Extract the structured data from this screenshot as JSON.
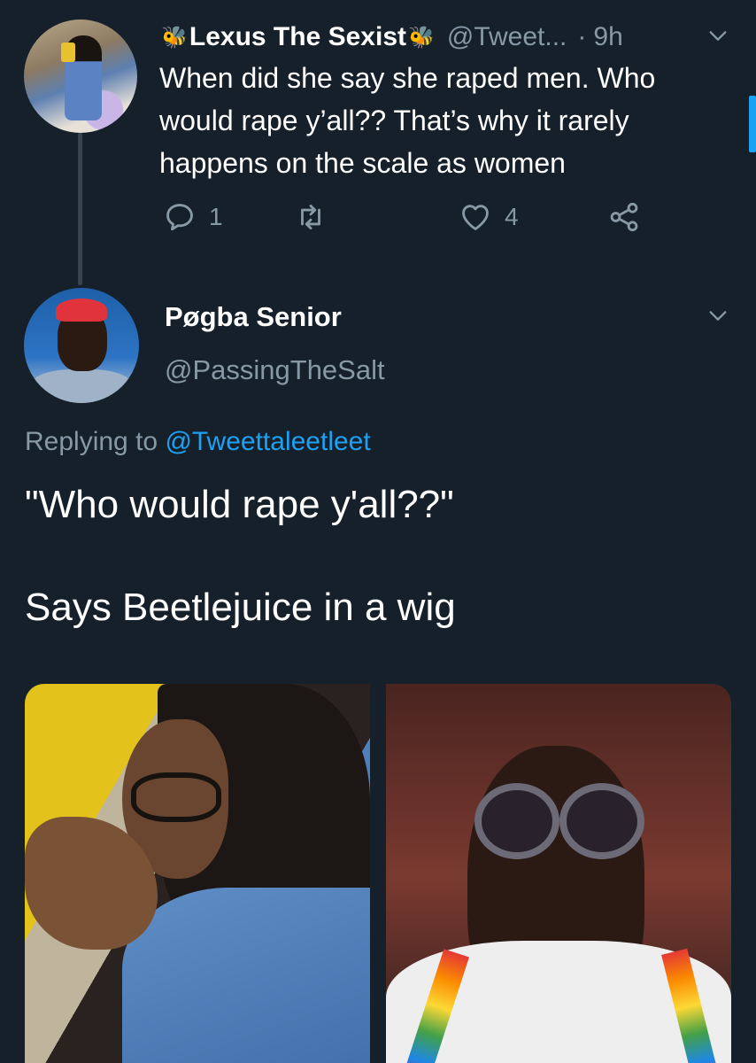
{
  "parent_tweet": {
    "display_name": "Lexus The Sexist",
    "name_emoji": "bee-emoji",
    "handle": "@Tweet...",
    "separator": "·",
    "time": "9h",
    "text": "When did she say she raped men. Who would rape y’all?? That’s why it rarely happens on the scale as women",
    "reply_count": "1",
    "retweet_count": "",
    "like_count": "4"
  },
  "reply_tweet": {
    "display_name": "Pøgba Senior",
    "handle": "@PassingTheSalt",
    "replying_prefix": "Replying to",
    "replying_to": "@Tweettaleetleet",
    "paragraphs": [
      "\"Who would rape y'all??\"",
      "Says Beetlejuice in a wig"
    ]
  },
  "colors": {
    "background": "#15202b",
    "text_primary": "#ffffff",
    "text_secondary": "#8899a6",
    "link": "#1da1f2",
    "thread_line": "#38444d"
  }
}
